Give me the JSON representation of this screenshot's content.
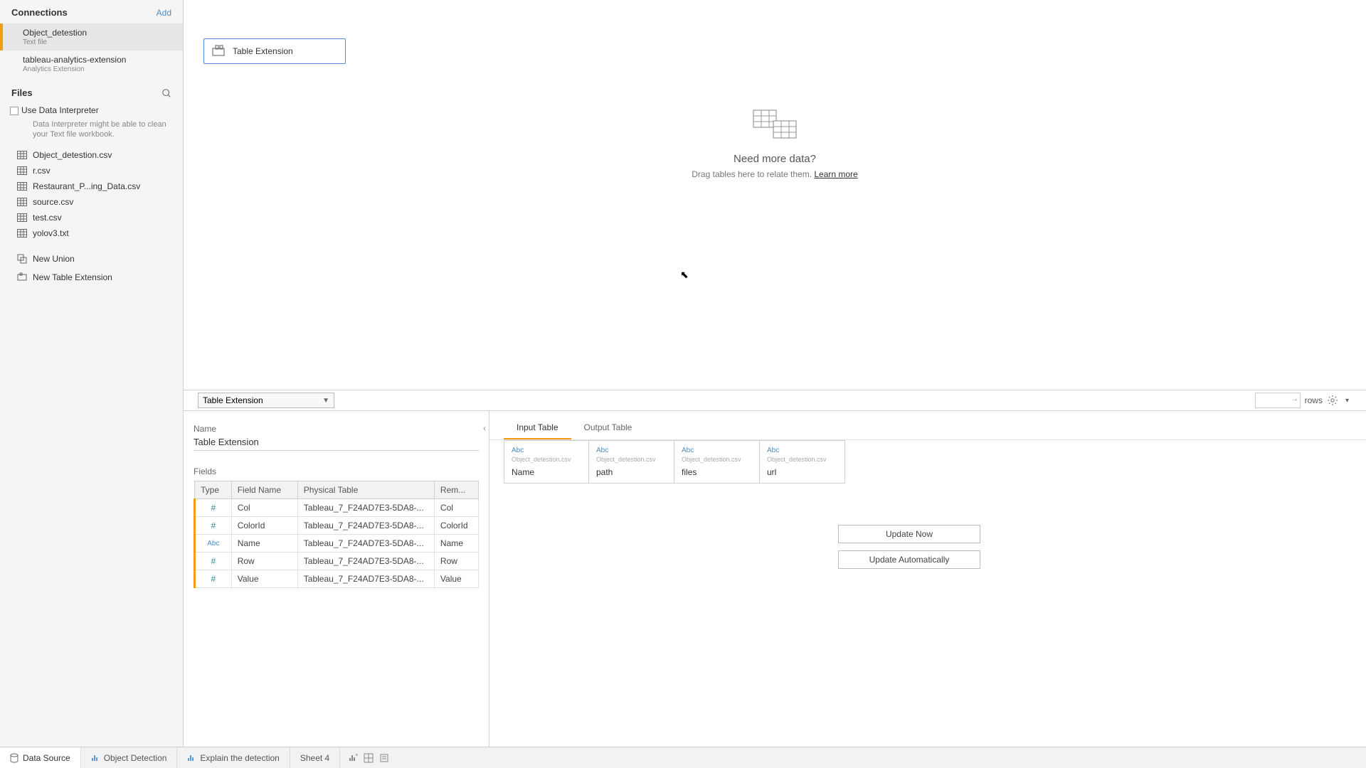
{
  "sidebar": {
    "connections_title": "Connections",
    "add_label": "Add",
    "connections": [
      {
        "name": "Object_detestion",
        "sub": "Text file",
        "active": true
      },
      {
        "name": "tableau-analytics-extension",
        "sub": "Analytics Extension",
        "active": false
      }
    ],
    "files_title": "Files",
    "interpreter_label": "Use Data Interpreter",
    "interpreter_note": "Data Interpreter might be able to clean your Text file workbook.",
    "files": [
      "Object_detestion.csv",
      "r.csv",
      "Restaurant_P...ing_Data.csv",
      "source.csv",
      "test.csv",
      "yolov3.txt"
    ],
    "actions": {
      "new_union": "New Union",
      "new_table_ext": "New Table Extension"
    }
  },
  "canvas": {
    "pill_label": "Table Extension",
    "empty_title": "Need more data?",
    "empty_text": "Drag tables here to relate them. ",
    "empty_link": "Learn more"
  },
  "midbar": {
    "datasource_name": "Table Extension",
    "rows_label": "rows"
  },
  "detail": {
    "name_label": "Name",
    "name_value": "Table Extension",
    "fields_label": "Fields",
    "headers": {
      "type": "Type",
      "field": "Field Name",
      "table": "Physical Table",
      "remote": "Rem..."
    },
    "rows": [
      {
        "type": "#",
        "field": "Col",
        "table": "Tableau_7_F24AD7E3-5DA8-...",
        "remote": "Col"
      },
      {
        "type": "#",
        "field": "ColorId",
        "table": "Tableau_7_F24AD7E3-5DA8-...",
        "remote": "ColorId"
      },
      {
        "type": "Abc",
        "field": "Name",
        "table": "Tableau_7_F24AD7E3-5DA8-...",
        "remote": "Name"
      },
      {
        "type": "#",
        "field": "Row",
        "table": "Tableau_7_F24AD7E3-5DA8-...",
        "remote": "Row"
      },
      {
        "type": "#",
        "field": "Value",
        "table": "Tableau_7_F24AD7E3-5DA8-...",
        "remote": "Value"
      }
    ]
  },
  "io": {
    "tab_input": "Input Table",
    "tab_output": "Output Table",
    "type_label": "Abc",
    "source_label": "Object_detestion.csv",
    "columns": [
      "Name",
      "path",
      "files",
      "url"
    ],
    "update_now": "Update Now",
    "update_auto": "Update Automatically"
  },
  "bottom_tabs": {
    "data_source": "Data Source",
    "sheets": [
      "Object Detection",
      "Explain the detection",
      "Sheet 4"
    ]
  }
}
